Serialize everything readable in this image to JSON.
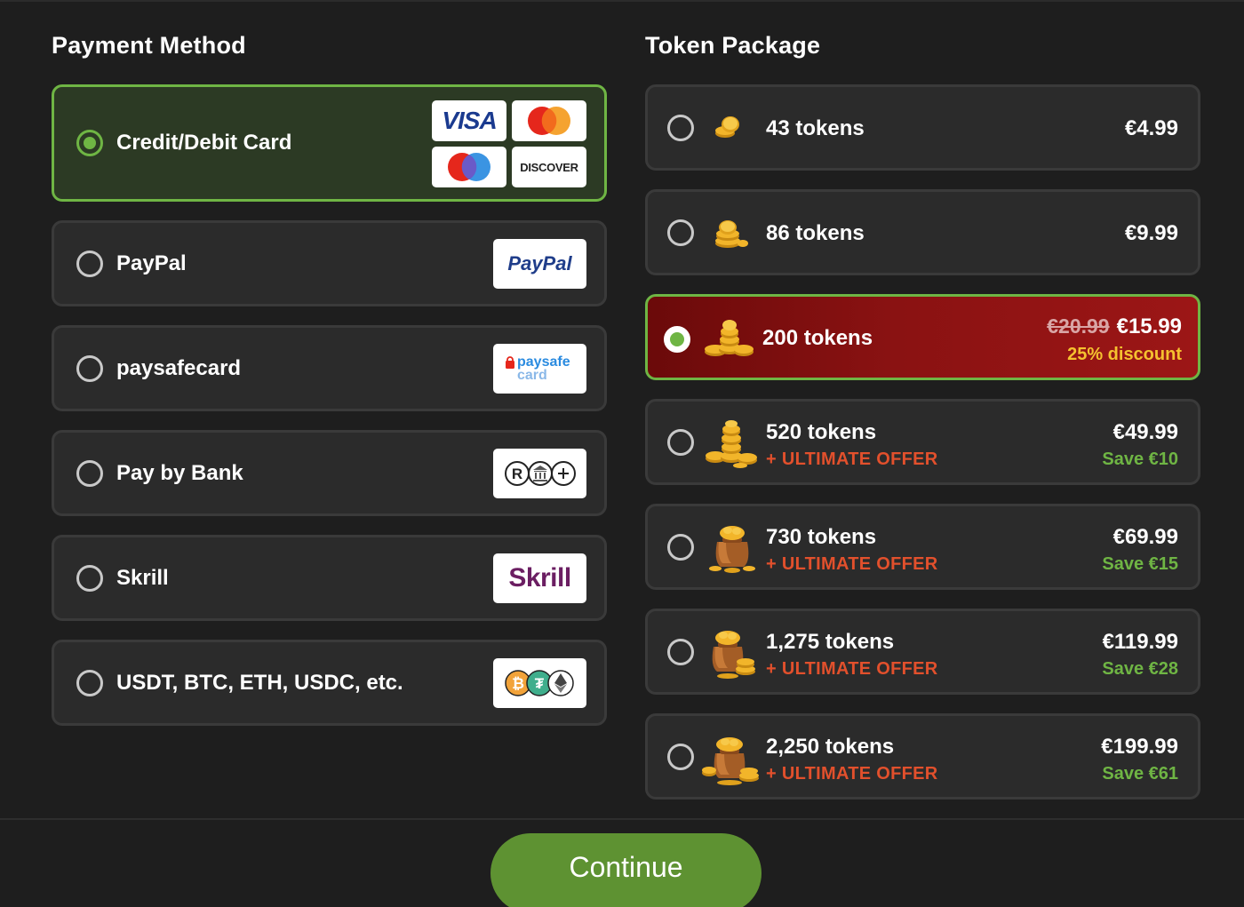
{
  "payment": {
    "title": "Payment Method",
    "methods": [
      {
        "label": "Credit/Debit Card",
        "selected": true,
        "logos": [
          "visa-logo",
          "mastercard-logo",
          "maestro-logo",
          "discover-logo"
        ]
      },
      {
        "label": "PayPal",
        "selected": false,
        "logo_text": "PayPal"
      },
      {
        "label": "paysafecard",
        "selected": false,
        "logo_text_top": "paysafe",
        "logo_text_bottom": "card"
      },
      {
        "label": "Pay by Bank",
        "selected": false,
        "logo": "bank-transfer-logo"
      },
      {
        "label": "Skrill",
        "selected": false,
        "logo_text": "Skrill"
      },
      {
        "label": "USDT, BTC, ETH, USDC, etc.",
        "selected": false,
        "logo": "crypto-logo"
      }
    ],
    "visa_text": "VISA",
    "discover_text": "DISCOVER"
  },
  "tokens": {
    "title": "Token Package",
    "packages": [
      {
        "label": "43 tokens",
        "price": "€4.99",
        "selected": false
      },
      {
        "label": "86 tokens",
        "price": "€9.99",
        "selected": false
      },
      {
        "label": "200 tokens",
        "old_price": "€20.99",
        "price": "€15.99",
        "discount": "25% discount",
        "selected": true
      },
      {
        "label": "520 tokens",
        "offer": "+ ULTIMATE OFFER",
        "price": "€49.99",
        "save": "Save €10",
        "selected": false
      },
      {
        "label": "730 tokens",
        "offer": "+ ULTIMATE OFFER",
        "price": "€69.99",
        "save": "Save €15",
        "selected": false
      },
      {
        "label": "1,275 tokens",
        "offer": "+ ULTIMATE OFFER",
        "price": "€119.99",
        "save": "Save €28",
        "selected": false
      },
      {
        "label": "2,250 tokens",
        "offer": "+ ULTIMATE OFFER",
        "price": "€199.99",
        "save": "Save €61",
        "selected": false
      }
    ]
  },
  "footer": {
    "continue_label": "Continue"
  },
  "colors": {
    "accent_green": "#6fb544",
    "offer_red": "#e2502c",
    "discount_yellow": "#f5c12f",
    "selected_red": "#8a1212"
  }
}
